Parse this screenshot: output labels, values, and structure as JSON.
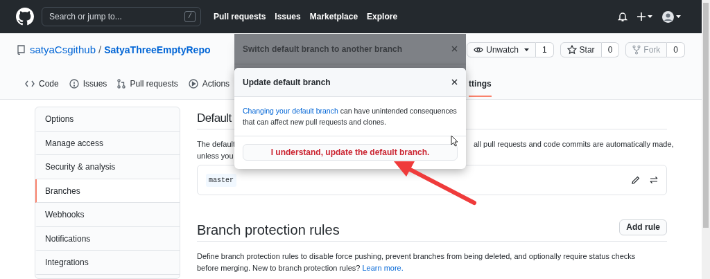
{
  "header": {
    "search": {
      "placeholder": "Search or jump to...",
      "shortcut": "/"
    },
    "nav": [
      "Pull requests",
      "Issues",
      "Marketplace",
      "Explore"
    ]
  },
  "repo": {
    "owner": "satyaCsgithub",
    "separator": "/",
    "name": "SatyaThreeEmptyRepo",
    "actions": [
      {
        "kind": "watch",
        "label": "Unwatch",
        "count": "1",
        "disabled": false
      },
      {
        "kind": "star",
        "label": "Star",
        "count": "0",
        "disabled": false
      },
      {
        "kind": "fork",
        "label": "Fork",
        "count": "0",
        "disabled": true
      }
    ]
  },
  "tabs": [
    {
      "kind": "code",
      "label": "Code",
      "selected": false
    },
    {
      "kind": "issue",
      "label": "Issues",
      "selected": false
    },
    {
      "kind": "pr",
      "label": "Pull requests",
      "selected": false
    },
    {
      "kind": "play",
      "label": "Actions",
      "selected": false
    },
    {
      "kind": "none",
      "label": "ttings",
      "selected": true
    }
  ],
  "sidebar": {
    "items": [
      {
        "label": "Options",
        "selected": false
      },
      {
        "label": "Manage access",
        "selected": false
      },
      {
        "label": "Security & analysis",
        "selected": false
      },
      {
        "label": "Branches",
        "selected": true
      },
      {
        "label": "Webhooks",
        "selected": false
      },
      {
        "label": "Notifications",
        "selected": false
      },
      {
        "label": "Integrations",
        "selected": false
      }
    ]
  },
  "default_branch": {
    "heading": "Default",
    "text_left": [
      "The default",
      "unless you"
    ],
    "text_right": "all pull requests and code commits are automatically made,",
    "branch": "master"
  },
  "protection": {
    "heading": "Branch protection rules",
    "button": "Add rule",
    "text": "Define branch protection rules to disable force pushing, prevent branches from being deleted, and optionally require status checks before merging. New to branch protection rules?",
    "link": "Learn more."
  },
  "back_dialog": {
    "title": "Switch default branch to another branch"
  },
  "dialog": {
    "title": "Update default branch",
    "link": "Changing your default branch",
    "text": "can have unintended consequences that can affect new pull requests and clones.",
    "button": "I understand, update the default branch."
  }
}
